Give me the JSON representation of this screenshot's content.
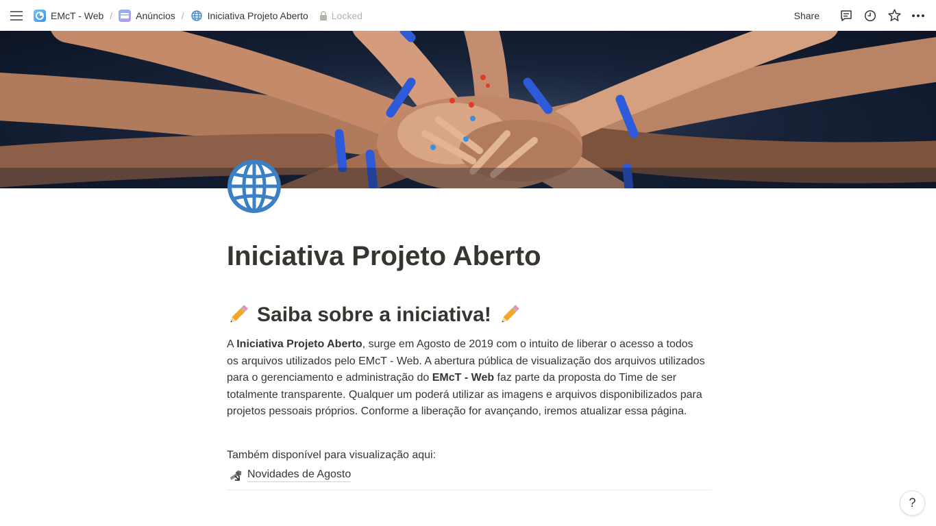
{
  "breadcrumbs": [
    {
      "label": "EMcT - Web",
      "icon": "emct-logo-icon"
    },
    {
      "label": "Anúncios",
      "icon": "card-icon"
    },
    {
      "label": "Iniciativa Projeto Aberto",
      "icon": "globe-icon"
    }
  ],
  "separator": "/",
  "locked_label": "Locked",
  "actions": {
    "share_label": "Share",
    "icons": [
      "comments-icon",
      "history-icon",
      "star-icon",
      "more-icon"
    ]
  },
  "cover": {
    "description_icon": "cover-image-hands"
  },
  "page": {
    "icon": "globe-icon",
    "title": "Iniciativa Projeto Aberto",
    "section_heading": "Saiba sobre a iniciativa!",
    "heading_emoji": "pencil-icon",
    "paragraph": {
      "part1": "A ",
      "bold1": "Iniciativa Projeto Aberto",
      "part2": ", surge em Agosto de 2019 com o intuito de liberar o acesso a todos os arquivos utilizados pelo EMcT - Web. A abertura pública de visualização dos arquivos utilizados para o gerenciamento e administração do ",
      "bold2": "EMcT - Web",
      "part3": " faz parte da proposta do Time de ser totalmente transparente. Qualquer um poderá utilizar as imagens e arquivos disponibilizados para projetos pessoais próprios. Conforme a liberação for avançando, iremos atualizar essa página."
    },
    "also_available": "Também disponível para visualização aqui:",
    "link": {
      "label": "Novidades de Agosto",
      "icon": "page-link-arrow-icon"
    }
  },
  "help_label": "?",
  "colors": {
    "text": "#37352f",
    "muted": "#b3b1ac",
    "globe": "#3b7fc4",
    "wristband": "#2d5ad8"
  }
}
